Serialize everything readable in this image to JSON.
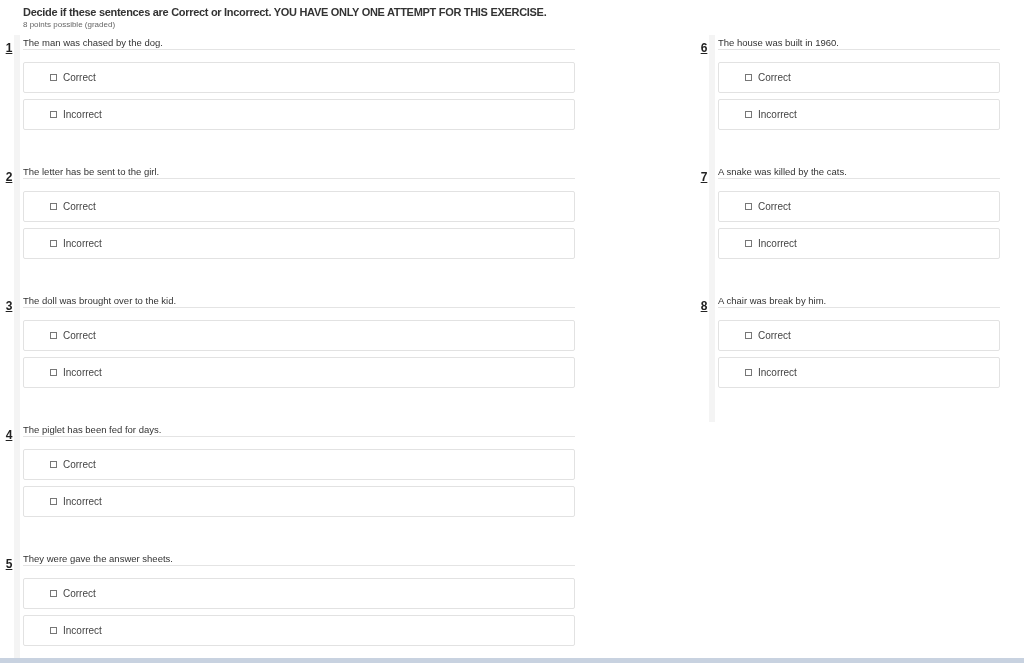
{
  "header": {
    "title": "Decide if these sentences are Correct or Incorrect. YOU HAVE ONLY ONE ATTEMPT FOR THIS EXERCISE.",
    "subtitle": "8 points possible (graded)"
  },
  "columns": [
    {
      "questions": [
        {
          "number": "1",
          "sentence": "The man was chased by the dog.",
          "options": [
            {
              "label": "Correct",
              "checked": false
            },
            {
              "label": "Incorrect",
              "checked": false
            }
          ]
        },
        {
          "number": "2",
          "sentence": "The letter has be sent to the girl.",
          "options": [
            {
              "label": "Correct",
              "checked": false
            },
            {
              "label": "Incorrect",
              "checked": false
            }
          ]
        },
        {
          "number": "3",
          "sentence": "The doll was brought over to the kid.",
          "options": [
            {
              "label": "Correct",
              "checked": false
            },
            {
              "label": "Incorrect",
              "checked": false
            }
          ]
        },
        {
          "number": "4",
          "sentence": "The piglet has been fed for days.",
          "options": [
            {
              "label": "Correct",
              "checked": false
            },
            {
              "label": "Incorrect",
              "checked": false
            }
          ]
        },
        {
          "number": "5",
          "sentence": "They were gave the answer sheets.",
          "options": [
            {
              "label": "Correct",
              "checked": false
            },
            {
              "label": "Incorrect",
              "checked": false
            }
          ]
        }
      ]
    },
    {
      "questions": [
        {
          "number": "6",
          "sentence": "The house was built in 1960.",
          "options": [
            {
              "label": "Correct",
              "checked": false
            },
            {
              "label": "Incorrect",
              "checked": false
            }
          ]
        },
        {
          "number": "7",
          "sentence": "A snake was killed by the cats.",
          "options": [
            {
              "label": "Correct",
              "checked": false
            },
            {
              "label": "Incorrect",
              "checked": false
            }
          ]
        },
        {
          "number": "8",
          "sentence": "A chair was break by him.",
          "options": [
            {
              "label": "Correct",
              "checked": false
            },
            {
              "label": "Incorrect",
              "checked": false
            }
          ]
        }
      ]
    }
  ]
}
